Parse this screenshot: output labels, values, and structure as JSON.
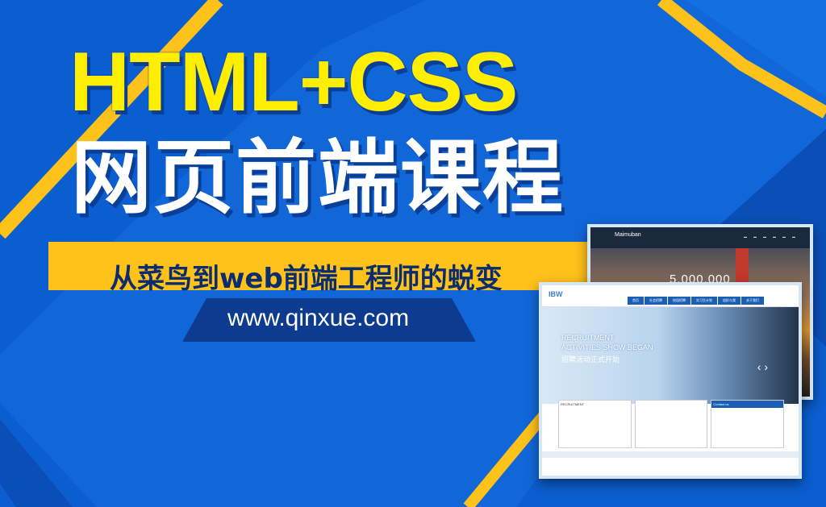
{
  "banner": {
    "title_en": "HTML+CSS",
    "title_cn": "网页前端课程",
    "subtitle": "从菜鸟到web前端工程师的蜕变",
    "url": "www.qinxue.com"
  },
  "screenshot_back": {
    "logo": "Maimuban",
    "nav": [
      "",
      "",
      "",
      "",
      "",
      "",
      ""
    ],
    "hero_number": "5,000,000"
  },
  "screenshot_front": {
    "logo": "IBW",
    "nav": [
      "首页",
      "社会招聘",
      "校园招聘",
      "实习生计划",
      "组织与我",
      "关于我们"
    ],
    "hero_line1": "RECRUITMENT",
    "hero_line2": "ACTIVITIES SHOW BEGAN",
    "hero_line3": "招聘活动正式开始",
    "card1_title": "RECRUITMENT",
    "card3_title": "Contact us"
  },
  "colors": {
    "background": "#0b5ed0",
    "accent_yellow": "#ffc21a",
    "title_yellow": "#ffee00",
    "dark_blue": "#0a3f98"
  }
}
